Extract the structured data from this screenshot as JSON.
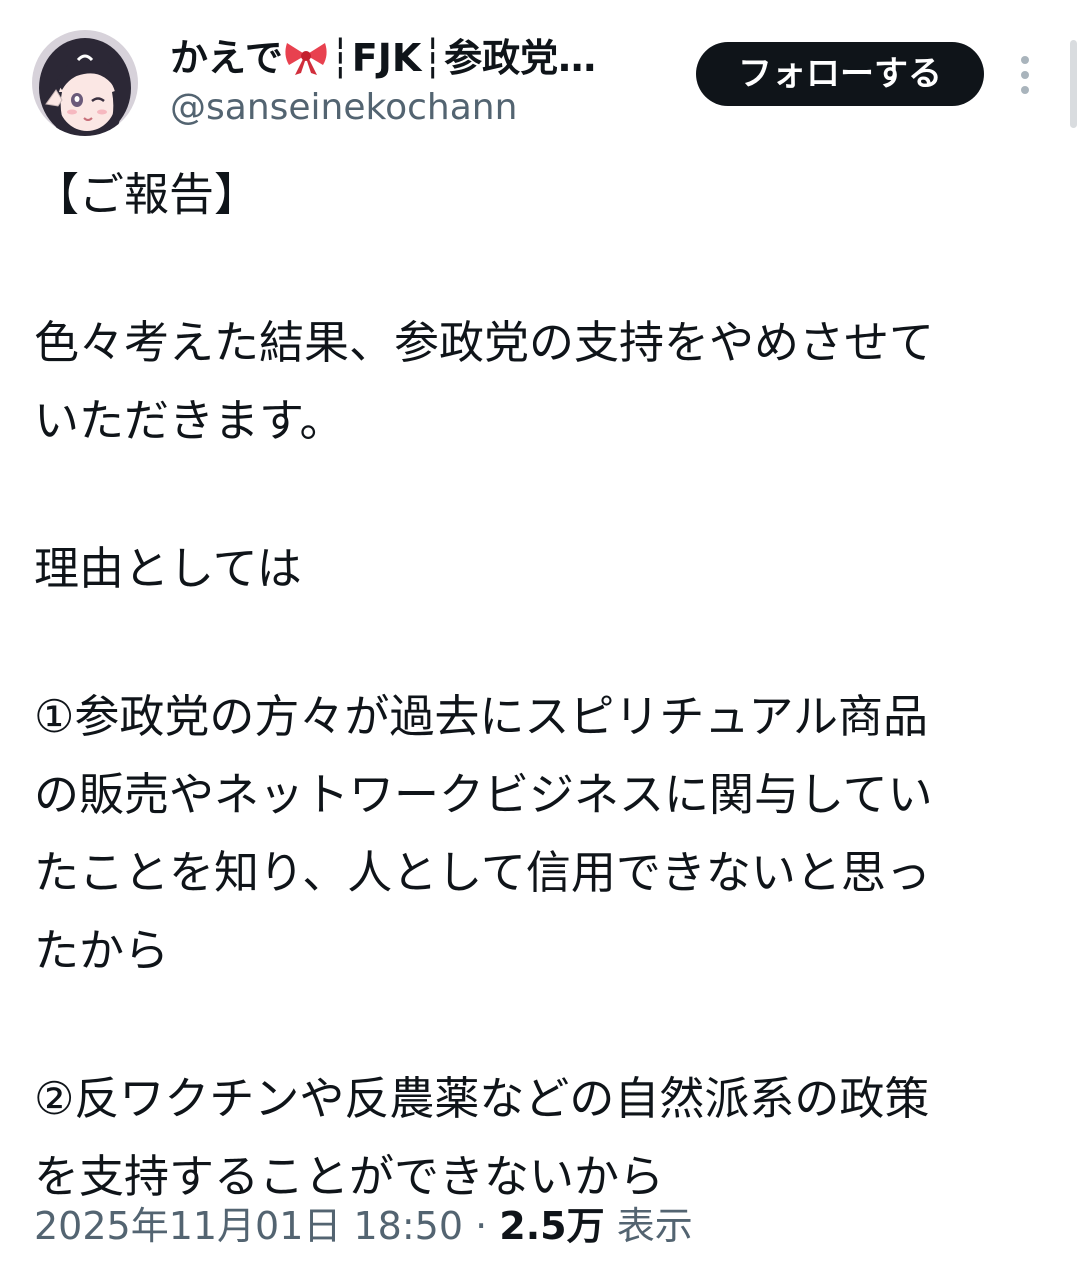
{
  "author": {
    "display_name_prefix": "かえで",
    "display_name_suffix": "┆FJK┆参政党…",
    "handle": "@sanseinekochann",
    "avatar_icon": "anime-girl-avatar",
    "bow_icon": "ribbon-emoji"
  },
  "actions": {
    "follow_label": "フォローする",
    "more_icon": "more-vertical-icon"
  },
  "tweet": {
    "title": "【ご報告】",
    "paragraph1": "色々考えた結果、参政党の支持をやめさせて\nいただきます。",
    "paragraph2": "理由としては",
    "reason1": "①参政党の方々が過去にスピリチュアル商品\nの販売やネットワークビジネスに関与してい\nたことを知り、人として信用できないと思っ\nたから",
    "reason2": "②反ワクチンや反農薬などの自然派系の政策\nを支持することができないから"
  },
  "meta": {
    "timestamp": "2025年11月01日 18:50",
    "separator": "·",
    "views_count": "2.5万",
    "views_label": "表示"
  },
  "colors": {
    "text_primary": "#0f1419",
    "text_secondary": "#536471",
    "button_bg": "#0f1419",
    "button_text": "#ffffff"
  }
}
